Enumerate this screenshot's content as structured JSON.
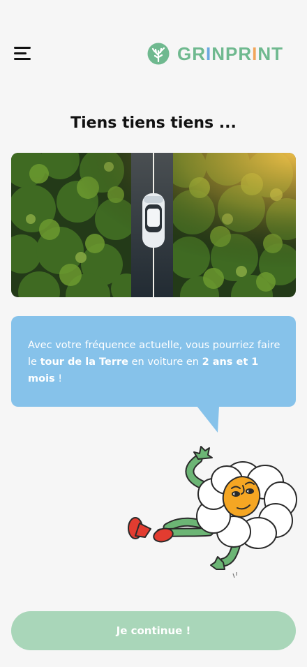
{
  "header": {
    "menu_icon": "hamburger-menu-icon",
    "logo_icon": "tree-icon",
    "logo_letters": [
      {
        "t": "GR",
        "c": "#6fb98f"
      },
      {
        "t": "I",
        "c": "#6aa8e0"
      },
      {
        "t": "NPR",
        "c": "#6fb98f"
      },
      {
        "t": "I",
        "c": "#f2a65a"
      },
      {
        "t": "NT",
        "c": "#6fb98f"
      }
    ]
  },
  "main": {
    "title": "Tiens tiens tiens ...",
    "bubble": {
      "part1": "Avec votre fréquence actuelle, vous pourriez faire le ",
      "bold1": "tour de la Terre",
      "part2": " en voiture en ",
      "bold2": "2 ans et 1 mois",
      "part3": " !"
    }
  },
  "footer": {
    "continue_label": "Je continue !"
  },
  "colors": {
    "accent_green": "#a9d6b9",
    "bubble_blue": "#86c2ea",
    "brand_green": "#6fb98f"
  }
}
